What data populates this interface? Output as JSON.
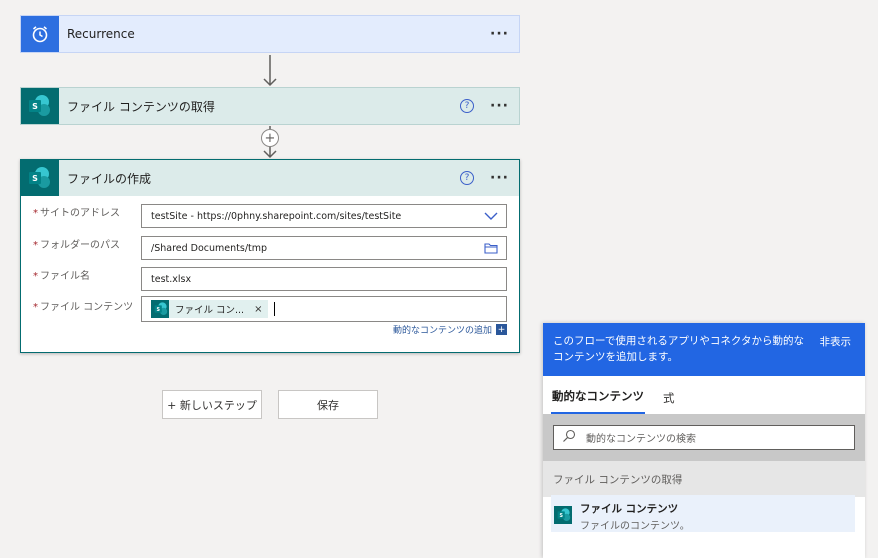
{
  "cards": {
    "recurrence": {
      "title": "Recurrence",
      "more": "···"
    },
    "get_content": {
      "title": "ファイル コンテンツの取得",
      "help": "?",
      "more": "···"
    },
    "create_file": {
      "title": "ファイルの作成",
      "help": "?",
      "more": "···",
      "fields": [
        {
          "label": "サイトのアドレス",
          "value": "testSite - https://0phny.sharepoint.com/sites/testSite"
        },
        {
          "label": "フォルダーのパス",
          "value": "/Shared Documents/tmp"
        },
        {
          "label": "ファイル名",
          "value": "test.xlsx"
        },
        {
          "label": "ファイル コンテンツ",
          "token": "ファイル コン...",
          "token_remove": "×"
        }
      ],
      "required_mark": "*",
      "dynamic_link": "動的なコンテンツの追加"
    }
  },
  "insert_step": "+",
  "buttons": {
    "new_step": "+ 新しいステップ",
    "save": "保存"
  },
  "panel": {
    "description": "このフローで使用されるアプリやコネクタから動的なコンテンツを追加します。",
    "hide": "非表示",
    "tabs": [
      "動的なコンテンツ",
      "式"
    ],
    "search_placeholder": "動的なコンテンツの検索",
    "group": "ファイル コンテンツの取得",
    "item": {
      "title": "ファイル コンテンツ",
      "subtitle": "ファイルのコンテンツ。"
    }
  },
  "icons": {
    "recurrence": "alarm-clock-icon",
    "sharepoint": "sharepoint-icon",
    "dropdown": "chevron-down-icon",
    "folder": "folder-icon",
    "search": "search-icon"
  },
  "colors": {
    "accent": "#2266e3",
    "sharepoint": "#036c70",
    "recurrence": "#2d6fe0"
  }
}
